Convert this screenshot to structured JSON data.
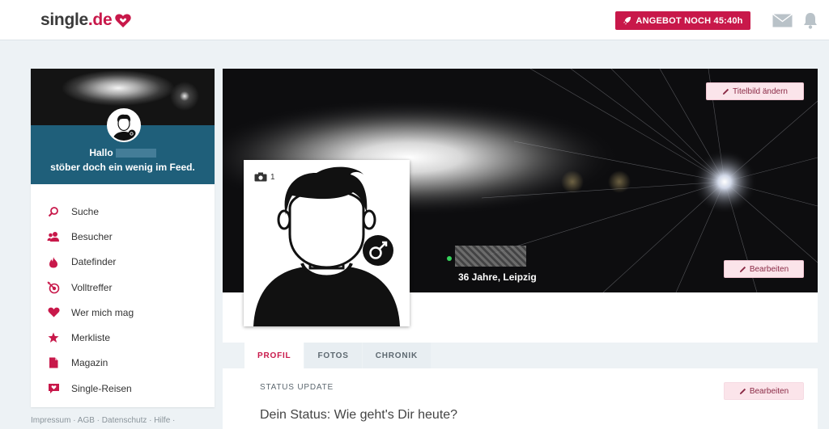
{
  "header": {
    "logo_text": "single",
    "logo_dot": ".de",
    "offer_button": "ANGEBOT NOCH 45:40h",
    "accent_color": "#c8184a"
  },
  "sidebar": {
    "greeting": "Hallo",
    "subtitle": "stöber doch ein wenig im Feed.",
    "items": [
      {
        "label": "Suche",
        "icon": "search-icon"
      },
      {
        "label": "Besucher",
        "icon": "visitors-icon"
      },
      {
        "label": "Datefinder",
        "icon": "flame-icon"
      },
      {
        "label": "Volltreffer",
        "icon": "target-icon"
      },
      {
        "label": "Wer mich mag",
        "icon": "heart-icon"
      },
      {
        "label": "Merkliste",
        "icon": "star-icon"
      },
      {
        "label": "Magazin",
        "icon": "document-icon"
      },
      {
        "label": "Single-Reisen",
        "icon": "heart-bubble-icon"
      }
    ]
  },
  "footer": {
    "links": "Impressum · AGB · Datenschutz · Hilfe ·"
  },
  "profile": {
    "cover_button": "Titelbild ändern",
    "edit_button": "Bearbeiten",
    "photo_count": "1",
    "age_location": "36 Jahre, Leipzig",
    "tabs": [
      "PROFIL",
      "FOTOS",
      "CHRONIK"
    ],
    "status_label": "STATUS UPDATE",
    "status_edit_button": "Bearbeiten",
    "status_text": "Dein Status: Wie geht's Dir heute?"
  }
}
